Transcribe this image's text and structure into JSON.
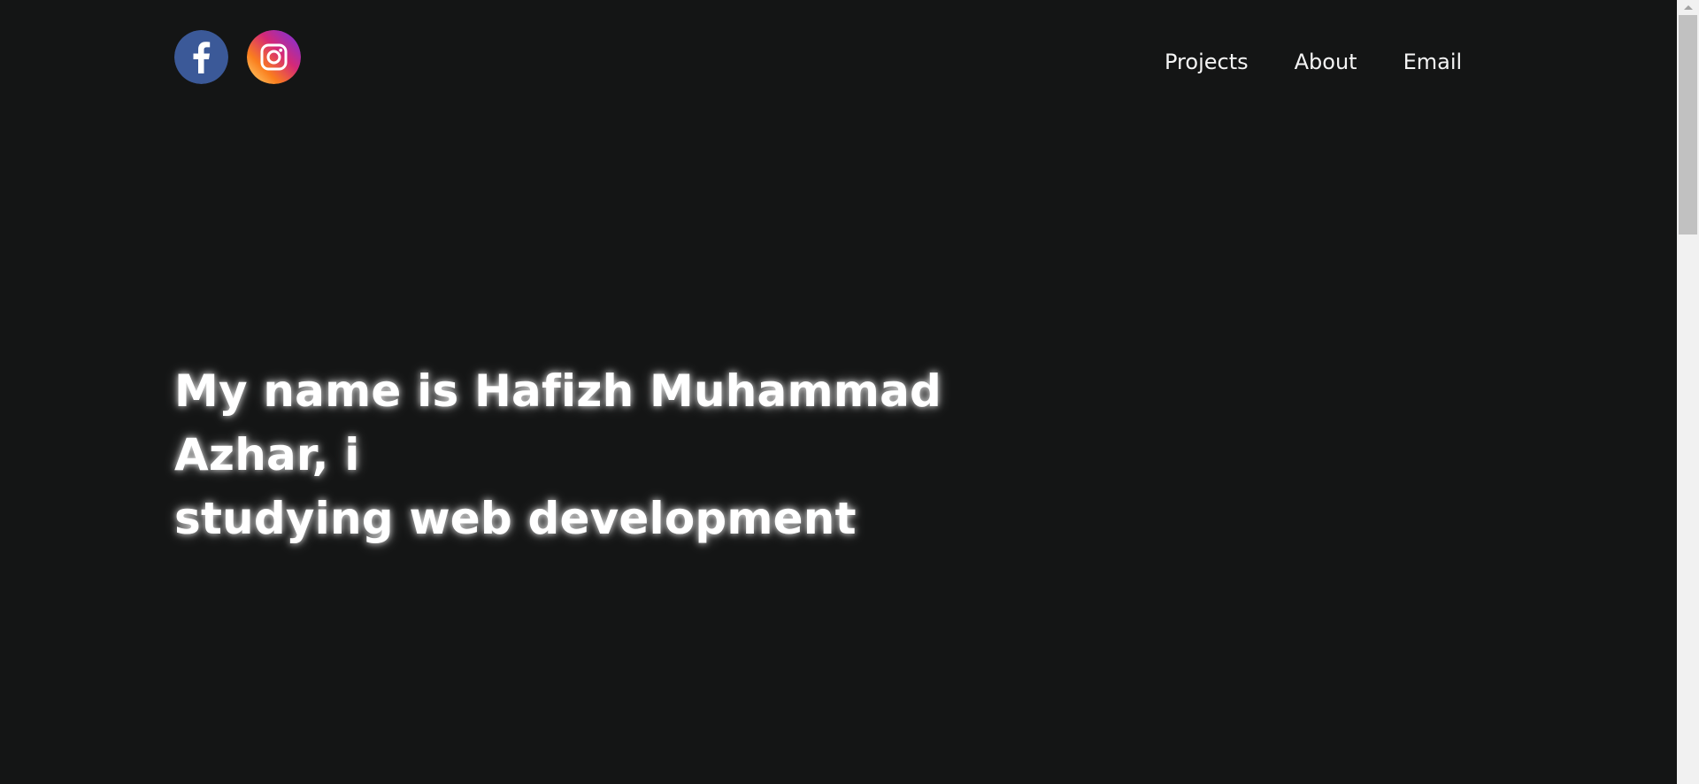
{
  "header": {
    "social": [
      {
        "icon": "facebook-icon",
        "label": "Facebook",
        "color": "#3b5998"
      },
      {
        "icon": "instagram-icon",
        "label": "Instagram",
        "colors": [
          "#feda75",
          "#fa7e1e",
          "#d62976",
          "#962fbf",
          "#4f5bd5"
        ]
      }
    ],
    "nav": [
      {
        "label": "Projects"
      },
      {
        "label": "About"
      },
      {
        "label": "Email"
      }
    ]
  },
  "hero": {
    "line1": "My name is Hafizh Muhammad Azhar, i",
    "line2": "studying web development"
  },
  "theme": {
    "background": "#141515",
    "text": "#ffffff",
    "scrollbar_track": "#f1f1f1",
    "scrollbar_thumb": "#c1c1c1"
  }
}
